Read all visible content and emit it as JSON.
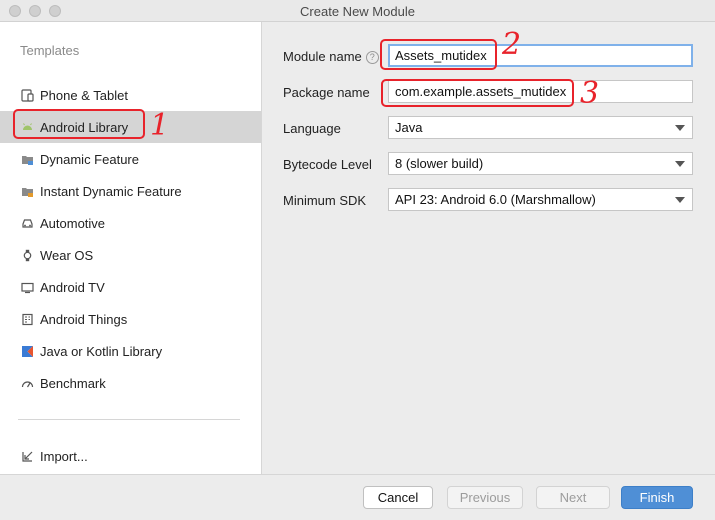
{
  "window": {
    "title": "Create New Module"
  },
  "sidebar": {
    "header": "Templates",
    "items": [
      {
        "label": "Phone & Tablet",
        "icon": "phone-tablet-icon"
      },
      {
        "label": "Android Library",
        "icon": "android-icon",
        "selected": true
      },
      {
        "label": "Dynamic Feature",
        "icon": "folder-feature-icon"
      },
      {
        "label": "Instant Dynamic Feature",
        "icon": "folder-instant-icon"
      },
      {
        "label": "Automotive",
        "icon": "car-icon"
      },
      {
        "label": "Wear OS",
        "icon": "watch-icon"
      },
      {
        "label": "Android TV",
        "icon": "tv-icon"
      },
      {
        "label": "Android Things",
        "icon": "things-board-icon"
      },
      {
        "label": "Java or Kotlin Library",
        "icon": "kotlin-icon"
      },
      {
        "label": "Benchmark",
        "icon": "gauge-icon"
      }
    ],
    "import_label": "Import..."
  },
  "form": {
    "module_name": {
      "label": "Module name",
      "value": "Assets_mutidex"
    },
    "package_name": {
      "label": "Package name",
      "value": "com.example.assets_mutidex"
    },
    "language": {
      "label": "Language",
      "value": "Java"
    },
    "bytecode": {
      "label": "Bytecode Level",
      "value": "8 (slower build)"
    },
    "min_sdk": {
      "label": "Minimum SDK",
      "value": "API 23: Android 6.0 (Marshmallow)"
    }
  },
  "annotations": {
    "one": "1",
    "two": "2",
    "three": "3"
  },
  "buttons": {
    "cancel": "Cancel",
    "previous": "Previous",
    "next": "Next",
    "finish": "Finish"
  },
  "colors": {
    "accent": "#4f8fd6",
    "annotation": "#e8232b",
    "selected_bg": "#d5d5d5"
  }
}
